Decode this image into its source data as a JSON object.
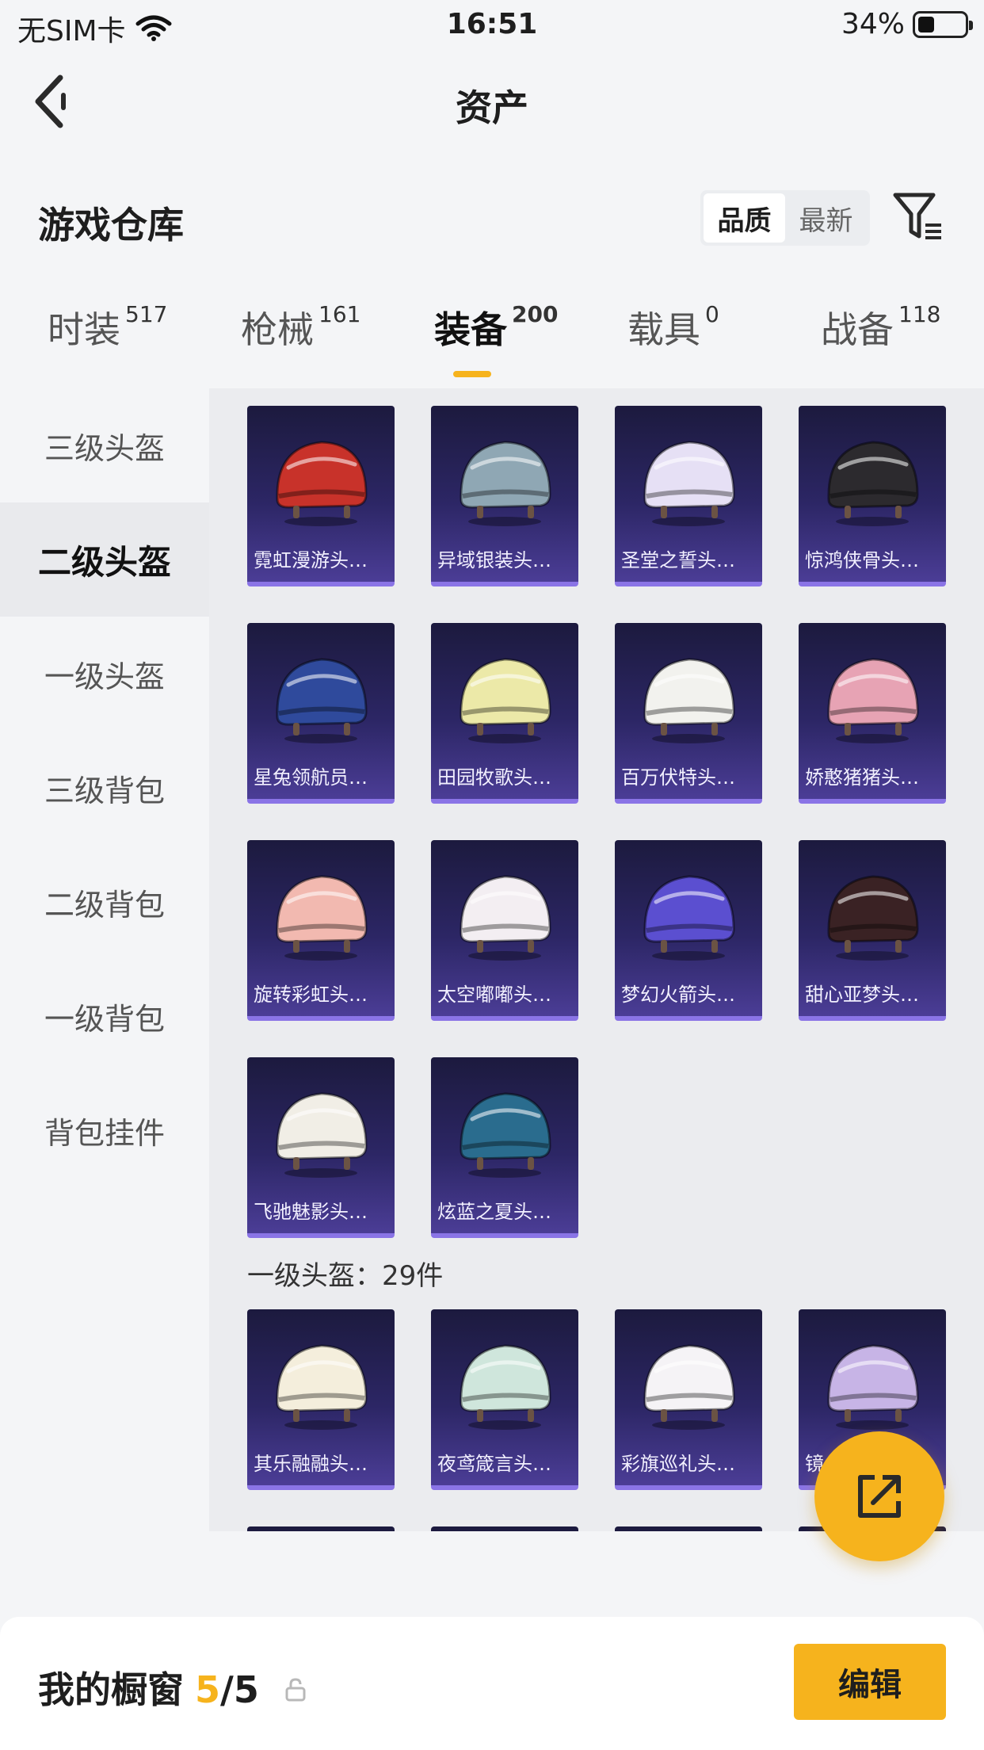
{
  "status_bar": {
    "carrier": "无SIM卡",
    "time": "16:51",
    "battery": "34%",
    "battery_level": 0.34
  },
  "nav": {
    "title": "资产"
  },
  "section": {
    "title": "游戏仓库"
  },
  "sort": {
    "options": [
      "品质",
      "最新"
    ],
    "selected": "品质"
  },
  "tabs": [
    {
      "label": "时装",
      "count": "517"
    },
    {
      "label": "枪械",
      "count": "161"
    },
    {
      "label": "装备",
      "count": "200"
    },
    {
      "label": "载具",
      "count": "0"
    },
    {
      "label": "战备",
      "count": "118"
    }
  ],
  "active_tab": "装备",
  "sidebar": {
    "items": [
      "三级头盔",
      "二级头盔",
      "一级头盔",
      "三级背包",
      "二级背包",
      "一级背包",
      "背包挂件"
    ],
    "selected": "二级头盔"
  },
  "groups": [
    {
      "label": "",
      "items": [
        {
          "name": "霓虹漫游头…",
          "icon": "red-helmet-icon",
          "color": "#c8322a"
        },
        {
          "name": "异域银装头…",
          "icon": "silver-helmet-icon",
          "color": "#8fa7b4"
        },
        {
          "name": "圣堂之誓头…",
          "icon": "white-winged-helmet-icon",
          "color": "#e6e0f5"
        },
        {
          "name": "惊鸿侠骨头…",
          "icon": "black-horned-helmet-icon",
          "color": "#2c2a2e"
        },
        {
          "name": "星兔领航员…",
          "icon": "blue-white-helmet-icon",
          "color": "#2f4a9c"
        },
        {
          "name": "田园牧歌头…",
          "icon": "yellow-bonnet-helmet-icon",
          "color": "#ece9a8"
        },
        {
          "name": "百万伏特头…",
          "icon": "cat-ear-helmet-icon",
          "color": "#f2f2ee"
        },
        {
          "name": "娇憨猪猪头…",
          "icon": "pink-pig-helmet-icon",
          "color": "#e7a3b4"
        },
        {
          "name": "旋转彩虹头…",
          "icon": "peach-dome-helmet-icon",
          "color": "#f2b9b0"
        },
        {
          "name": "太空嘟嘟头…",
          "icon": "white-bunny-helmet-icon",
          "color": "#f3eef2"
        },
        {
          "name": "梦幻火箭头…",
          "icon": "galaxy-helmet-icon",
          "color": "#5b4fd0"
        },
        {
          "name": "甜心亚梦头…",
          "icon": "black-bow-helmet-icon",
          "color": "#3a2224"
        },
        {
          "name": "飞驰魅影头…",
          "icon": "white-gold-helmet-icon",
          "color": "#f1eee6"
        },
        {
          "name": "炫蓝之夏头…",
          "icon": "blue-wave-helmet-icon",
          "color": "#2a6c8e"
        }
      ]
    },
    {
      "label": "一级头盔：29件",
      "items": [
        {
          "name": "其乐融融头…",
          "icon": "cream-helmet-icon",
          "color": "#f4eedc"
        },
        {
          "name": "夜鸢箴言头…",
          "icon": "mint-fish-helmet-icon",
          "color": "#cfe6dc"
        },
        {
          "name": "彩旗巡礼头…",
          "icon": "cow-helmet-icon",
          "color": "#f5f3f6"
        },
        {
          "name": "镜…",
          "icon": "lavender-helmet-icon",
          "color": "#c7b4e6"
        }
      ]
    }
  ],
  "fab": {
    "icon": "share-export-icon"
  },
  "showcase": {
    "label": "我的橱窗",
    "current": "5",
    "total": "/5",
    "edit_label": "编辑"
  }
}
